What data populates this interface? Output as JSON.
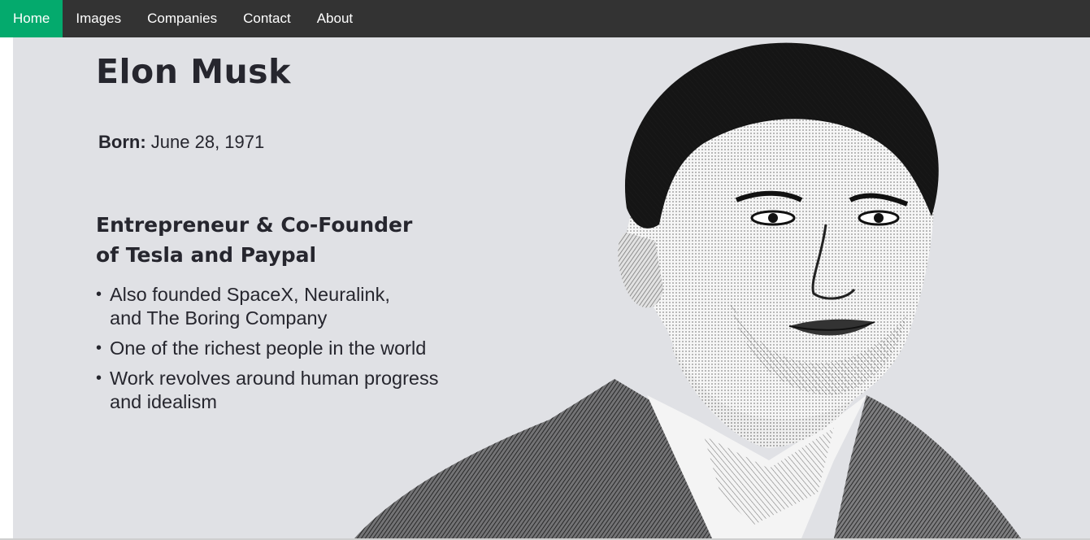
{
  "nav": {
    "items": [
      {
        "label": "Home",
        "active": true
      },
      {
        "label": "Images",
        "active": false
      },
      {
        "label": "Companies",
        "active": false
      },
      {
        "label": "Contact",
        "active": false
      },
      {
        "label": "About",
        "active": false
      }
    ],
    "active_color": "#04AA6D",
    "bar_color": "#333333"
  },
  "hero": {
    "name": "Elon Musk",
    "born_label": "Born:",
    "born_value": "June 28, 1971",
    "headline_line1": "Entrepreneur & Co-Founder",
    "headline_line2": "of Tesla and Paypal",
    "facts": [
      {
        "line1": "Also founded SpaceX, Neuralink,",
        "line2": "and The Boring Company"
      },
      {
        "line1": "One of the richest people in the world",
        "line2": ""
      },
      {
        "line1": "Work revolves around human progress",
        "line2": "and idealism"
      }
    ],
    "portrait": "engraved-portrait-illustration",
    "background_color": "#e0e1e5"
  }
}
